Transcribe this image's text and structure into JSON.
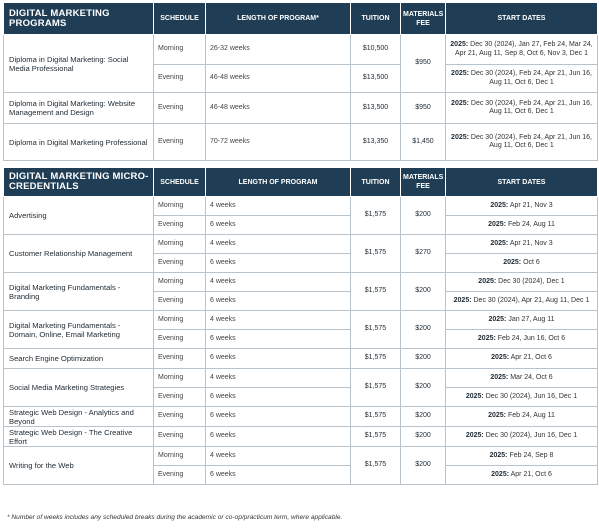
{
  "programs": {
    "title": "DIGITAL MARKETING PROGRAMS",
    "headers": {
      "schedule": "SCHEDULE",
      "length": "LENGTH OF PROGRAM*",
      "tuition": "TUITION",
      "materials": "MATERIALS FEE",
      "start": "START DATES"
    },
    "rows": [
      {
        "name": "Diploma in Digital Marketing: Social Media Professional",
        "materials": "$950",
        "sessions": [
          {
            "schedule": "Morning",
            "length": "26-32 weeks",
            "tuition": "$10,500",
            "year": "2025:",
            "dates": "Dec 30 (2024), Jan 27, Feb 24, Mar 24, Apr 21, Aug 11, Sep 8, Oct 6, Nov 3, Dec 1"
          },
          {
            "schedule": "Evening",
            "length": "46-48 weeks",
            "tuition": "$13,500",
            "year": "2025:",
            "dates": "Dec 30 (2024), Feb 24, Apr 21, Jun 16, Aug 11, Oct 6, Dec 1"
          }
        ]
      },
      {
        "name": "Diploma in Digital Marketing: Website Management and Design",
        "materials": "$950",
        "sessions": [
          {
            "schedule": "Evening",
            "length": "46-48 weeks",
            "tuition": "$13,500",
            "year": "2025:",
            "dates": "Dec 30 (2024), Feb 24, Apr 21, Jun 16, Aug 11, Oct 6, Dec 1"
          }
        ]
      },
      {
        "name": "Diploma in Digital Marketing Professional",
        "materials": "$1,450",
        "sessions": [
          {
            "schedule": "Evening",
            "length": "70-72 weeks",
            "tuition": "$13,350",
            "year": "2025:",
            "dates": "Dec 30 (2024), Feb 24, Apr 21, Jun 16, Aug 11, Oct 6, Dec 1"
          }
        ]
      }
    ]
  },
  "micro": {
    "title": "DIGITAL MARKETING MICRO-CREDENTIALS",
    "headers": {
      "schedule": "SCHEDULE",
      "length": "LENGTH OF PROGRAM",
      "tuition": "TUITION",
      "materials": "MATERIALS FEE",
      "start": "START DATES"
    },
    "rows": [
      {
        "name": "Advertising",
        "tuition": "$1,575",
        "materials": "$200",
        "sessions": [
          {
            "schedule": "Morning",
            "length": "4 weeks",
            "year": "2025:",
            "dates": "Apr 21, Nov 3"
          },
          {
            "schedule": "Evening",
            "length": "6 weeks",
            "year": "2025:",
            "dates": "Feb 24, Aug 11"
          }
        ]
      },
      {
        "name": "Customer Relationship Management",
        "tuition": "$1,575",
        "materials": "$270",
        "sessions": [
          {
            "schedule": "Morning",
            "length": "4 weeks",
            "year": "2025:",
            "dates": "Apr 21, Nov 3"
          },
          {
            "schedule": "Evening",
            "length": "6 weeks",
            "year": "2025:",
            "dates": "Oct 6"
          }
        ]
      },
      {
        "name": "Digital Marketing Fundamentals - Branding",
        "tuition": "$1,575",
        "materials": "$200",
        "sessions": [
          {
            "schedule": "Morning",
            "length": "4 weeks",
            "year": "2025:",
            "dates": "Dec 30 (2024), Dec 1"
          },
          {
            "schedule": "Evening",
            "length": "6 weeks",
            "year": "2025:",
            "dates": "Dec 30 (2024), Apr 21, Aug 11, Dec 1"
          }
        ]
      },
      {
        "name": "Digital Marketing Fundamentals - Domain, Online, Email Marketing",
        "tuition": "$1,575",
        "materials": "$200",
        "sessions": [
          {
            "schedule": "Morning",
            "length": "4 weeks",
            "year": "2025:",
            "dates": "Jan 27, Aug 11"
          },
          {
            "schedule": "Evening",
            "length": "6 weeks",
            "year": "2025:",
            "dates": "Feb 24, Jun 16, Oct 6"
          }
        ]
      },
      {
        "name": "Search Engine Optimization",
        "tuition": "$1,575",
        "materials": "$200",
        "sessions": [
          {
            "schedule": "Evening",
            "length": "6 weeks",
            "year": "2025:",
            "dates": "Apr 21, Oct 6"
          }
        ]
      },
      {
        "name": "Social Media Marketing Strategies",
        "tuition": "$1,575",
        "materials": "$200",
        "sessions": [
          {
            "schedule": "Morning",
            "length": "4 weeks",
            "year": "2025:",
            "dates": "Mar 24, Oct 6"
          },
          {
            "schedule": "Evening",
            "length": "6 weeks",
            "year": "2025:",
            "dates": "Dec 30 (2024), Jun 16, Dec 1"
          }
        ]
      },
      {
        "name": "Strategic Web Design - Analytics and Beyond",
        "tuition": "$1,575",
        "materials": "$200",
        "sessions": [
          {
            "schedule": "Evening",
            "length": "6 weeks",
            "year": "2025:",
            "dates": "Feb 24, Aug 11"
          }
        ]
      },
      {
        "name": "Strategic Web Design - The Creative Effort",
        "tuition": "$1,575",
        "materials": "$200",
        "sessions": [
          {
            "schedule": "Evening",
            "length": "6 weeks",
            "year": "2025:",
            "dates": "Dec 30 (2024), Jun 16, Dec 1"
          }
        ]
      },
      {
        "name": "Writing for the Web",
        "tuition": "$1,575",
        "materials": "$200",
        "sessions": [
          {
            "schedule": "Morning",
            "length": "4 weeks",
            "year": "2025:",
            "dates": "Feb 24, Sep 8"
          },
          {
            "schedule": "Evening",
            "length": "6 weeks",
            "year": "2025:",
            "dates": "Apr 21, Oct 6"
          }
        ]
      }
    ]
  },
  "footnote": "* Number of weeks includes any scheduled breaks during the academic or co-op/practicum term, where applicable."
}
